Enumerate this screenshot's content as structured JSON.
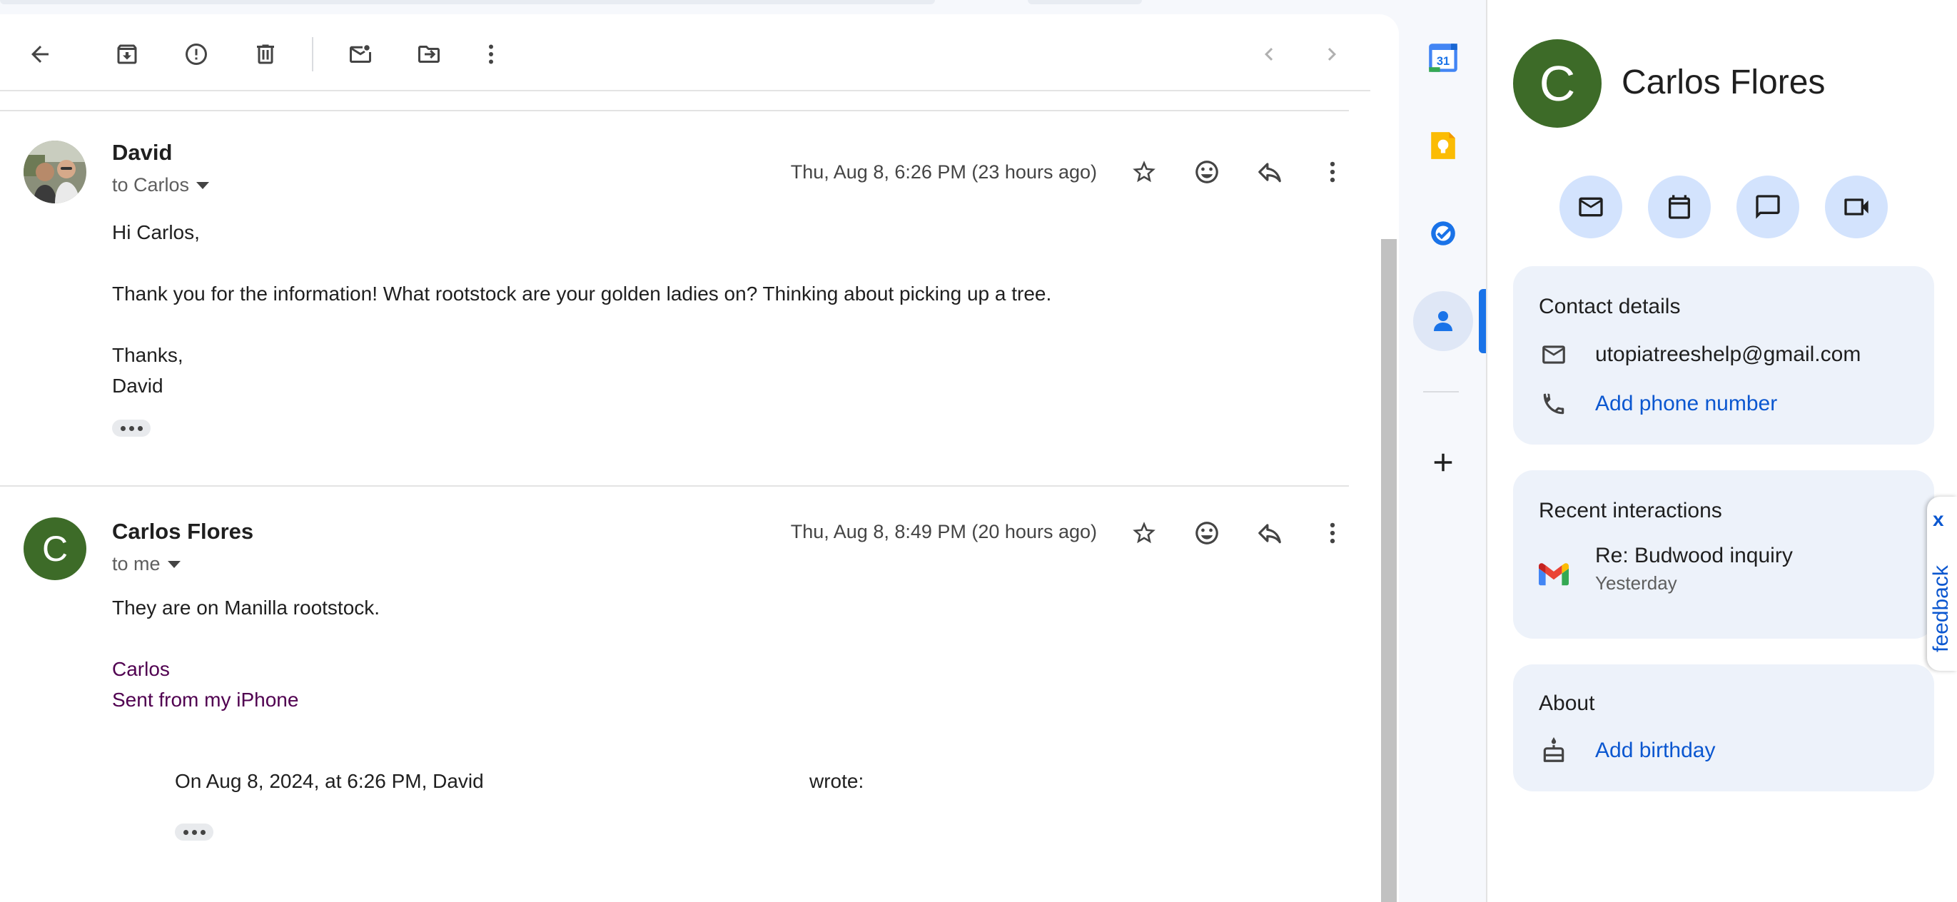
{
  "messages": [
    {
      "sender": "David",
      "recipient": "to Carlos",
      "date": "Thu, Aug 8, 6:26 PM (23 hours ago)",
      "lines": [
        "Hi Carlos,",
        "Thank you for the information! What rootstock are your golden ladies on? Thinking about picking up a tree.",
        "Thanks,",
        "David"
      ]
    },
    {
      "sender": "Carlos Flores",
      "avatar_letter": "C",
      "recipient": "to me",
      "date": "Thu, Aug 8, 8:49 PM (20 hours ago)",
      "lines": [
        "They are on Manilla rootstock.",
        "Carlos",
        "Sent from my iPhone"
      ],
      "quote_header_left": "On Aug 8, 2024, at 6:26 PM, David",
      "quote_header_right": "wrote:"
    }
  ],
  "side_icons": [
    "calendar-icon",
    "keep-icon",
    "tasks-icon",
    "contacts-icon",
    "add-icon"
  ],
  "calendar_day": "31",
  "contact": {
    "avatar_letter": "C",
    "name": "Carlos Flores",
    "details_title": "Contact details",
    "email": "utopiatreeshelp@gmail.com",
    "add_phone": "Add phone number",
    "recent_title": "Recent interactions",
    "recent_subject": "Re: Budwood inquiry",
    "recent_when": "Yesterday",
    "about_title": "About",
    "add_birthday": "Add birthday"
  },
  "feedback": {
    "label": "feedback",
    "close": "x"
  },
  "colors": {
    "accent": "#0b57d0",
    "avatar_green": "#3d6b28",
    "signature_purple": "#500050",
    "action_bg": "#d3e3fd",
    "card_bg": "#edf2fa"
  }
}
